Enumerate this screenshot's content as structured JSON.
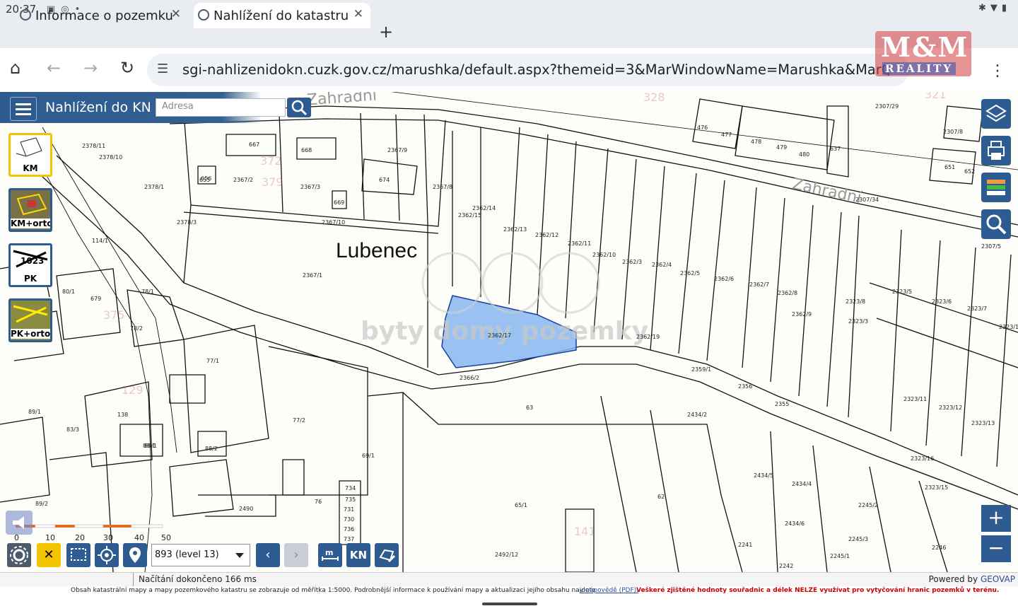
{
  "status_bar": {
    "time": "20:37"
  },
  "browser": {
    "tabs": [
      {
        "title": "Informace o pozemku",
        "active": false
      },
      {
        "title": "Nahlížení do katastru",
        "active": true
      }
    ],
    "url": "sgi-nahlizenidokn.cuzk.gov.cz/marushka/default.aspx?themeid=3&MarWindowName=Marushka&MarQu"
  },
  "watermark": {
    "logo_top": "M&M",
    "logo_bottom": "REALITY",
    "overlay_text": "byty domy pozemky"
  },
  "app": {
    "title": "Nahlížení do KN",
    "address_placeholder": "Adresa",
    "layers": [
      {
        "label": "KM",
        "selected": true
      },
      {
        "label": "KM+orto",
        "selected": false
      },
      {
        "label": "PK",
        "selected": false
      },
      {
        "label": "PK+orto",
        "selected": false
      }
    ],
    "scale_select": "893 (level 13)",
    "scalebar_labels": [
      "0",
      "10",
      "20",
      "30",
      "40",
      "50 m"
    ],
    "kn_button": "KN",
    "status": "Načítání dokončeno 166 ms",
    "powered_by": "Powered by",
    "powered_brand": "GEOVAP",
    "footer_text": "Obsah katastrální mapy a mapy pozemkového katastru se zobrazuje od měřítka 1:5000. Podrobnější informace k používání mapy a aktualizaci jejího obsahu najdete",
    "footer_link": "v nápovědě (PDF).",
    "footer_warning": "Veškeré zjištěné hodnoty souřadnic a délek NELZE využívat pro vytyčování hranic pozemků v terénu."
  },
  "map_labels": {
    "place": "Lubenec",
    "streets": [
      "Zahradní",
      "Zahradní"
    ],
    "parcels": [
      "2367/9",
      "2367/8",
      "2367/3",
      "2367/2",
      "2367/10",
      "2367/1",
      "2362/15",
      "2362/14",
      "2362/13",
      "2362/12",
      "2362/11",
      "2362/10",
      "2362/3",
      "2362/4",
      "2362/5",
      "2362/6",
      "2362/7",
      "2362/8",
      "2362/9",
      "2362/17",
      "2362/19",
      "2366/2",
      "2359/1",
      "2356",
      "2355",
      "2323/5",
      "2323/6",
      "2323/7",
      "2323/8",
      "2323/3",
      "2323/10",
      "2323/11",
      "2323/12",
      "2323/13",
      "2323/15",
      "2323/16",
      "2307/5",
      "2307/29",
      "2307/8",
      "2307/34",
      "2378/1",
      "2378/3",
      "2378/10",
      "2378/11",
      "114/1",
      "80/1",
      "78/1",
      "78/2",
      "77/1",
      "77/2",
      "88/1",
      "88/2",
      "89/1",
      "89/2",
      "83/3",
      "69/1",
      "65/1",
      "62",
      "63",
      "76",
      "2490",
      "2492/12",
      "2434/2",
      "2434/4",
      "2434/5",
      "2434/6",
      "2245/1",
      "2245/2",
      "2245/3",
      "2246",
      "2241",
      "2242",
      "139",
      "138",
      "88/1",
      "674",
      "669",
      "667",
      "668",
      "655",
      "656",
      "679",
      "476",
      "477",
      "478",
      "479",
      "480",
      "637",
      "652",
      "651"
    ],
    "building_numbers": [
      "734",
      "735",
      "731",
      "730",
      "736",
      "737"
    ],
    "house_numbers": [
      "375",
      "379",
      "372",
      "129",
      "141",
      "328",
      "321"
    ]
  }
}
